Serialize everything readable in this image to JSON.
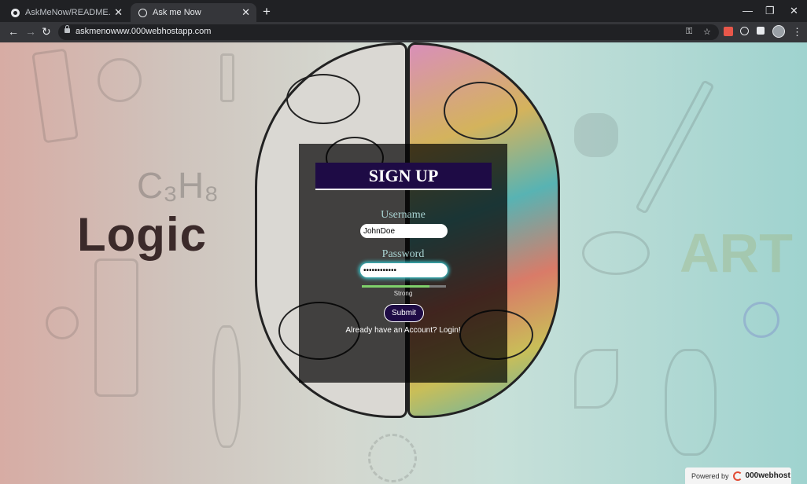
{
  "browser": {
    "tabs": [
      {
        "title": "AskMeNow/README.md at mas",
        "active": false,
        "favicon": "github-icon"
      },
      {
        "title": "Ask me Now",
        "active": true,
        "favicon": "globe-icon"
      }
    ],
    "new_tab_glyph": "+",
    "close_glyph": "✕",
    "window_controls": {
      "minimize": "—",
      "maximize": "❐",
      "close": "✕"
    },
    "nav": {
      "back": "←",
      "forward": "→",
      "reload": "↻"
    },
    "url": "askmenowww.000webhostapp.com",
    "omnibox_icons": {
      "key": "⚿",
      "star": "☆"
    },
    "menu_glyph": "⋮",
    "extension_colors": [
      "#e8574a",
      "#e8eaed",
      "#e8eaed"
    ]
  },
  "page": {
    "background": {
      "left_word": "Logic",
      "right_word": "ART",
      "formula": "C₃H₈"
    },
    "form": {
      "title": "SIGN UP",
      "username_label": "Username",
      "username_value": "JohnDoe",
      "password_label": "Password",
      "password_value": "••••••••••••",
      "strength": {
        "label": "Strong",
        "level": 0.8,
        "color": "#7fd16b"
      },
      "submit_label": "Submit",
      "login_text": "Already have an Account? Login!"
    },
    "hosting_badge": {
      "prefix": "Powered by",
      "brand": "000webhost"
    },
    "colors": {
      "header_bg": "#1e0b45",
      "field_glow": "#3cc9d0",
      "label_color": "#a9d4d3"
    }
  }
}
